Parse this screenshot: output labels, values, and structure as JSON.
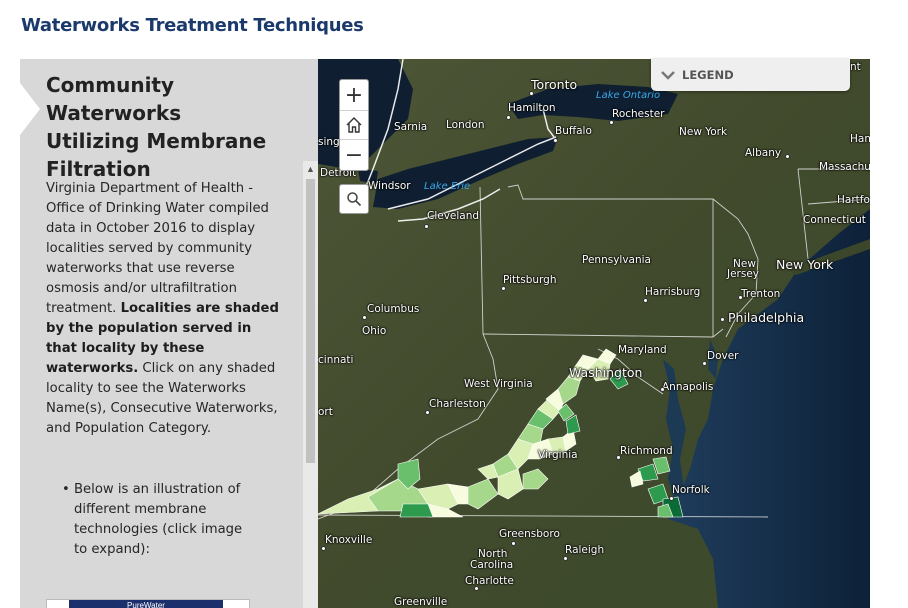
{
  "app": {
    "title": "Waterworks Treatment Techniques"
  },
  "panel": {
    "heading_line1": "Community Waterworks",
    "heading_line2": "Utilizing Membrane",
    "heading_line3": "Filtration",
    "body_intro": "Virginia Department of Health - Office of Drinking Water compiled data in October 2016 to display localities served by community waterworks that use reverse osmosis and/or ultrafiltration treatment.",
    "body_bold": "Localities are shaded by the population served in that locality by these waterworks.",
    "body_tail": "Click on any shaded locality to see the Waterworks Name(s), Consecutive Waterworks, and Population Category.",
    "bullet": "Below is an illustration of different membrane technologies (click image to expand):",
    "thumbnail_text": "PureWater"
  },
  "legend": {
    "label": "LEGEND",
    "icon": "chevron-down-icon"
  },
  "controls": {
    "zoom_in": "+",
    "zoom_out": "−",
    "home_icon": "home-icon",
    "search_icon": "search-icon"
  },
  "map": {
    "water_labels": [
      "Lake Ontario",
      "Lake Erie"
    ],
    "place_labels": [
      "Toronto",
      "Hamilton",
      "Sarnia",
      "London",
      "Rochester",
      "Buffalo",
      "New York",
      "Albany",
      "Massachu",
      "Hartfor",
      "Connecticut",
      "Windsor",
      "Detroit",
      "sing",
      "Cleveland",
      "Pennsylvania",
      "Pittsburgh",
      "Harrisburg",
      "New",
      "Jersey",
      "New York",
      "Trenton",
      "Philadelphia",
      "Columbus",
      "Ohio",
      "Maryland",
      "Dover",
      "cinnati",
      "Washington",
      "West Virginia",
      "Annapolis",
      "Charleston",
      "ort",
      "Virginia",
      "Richmond",
      "Norfolk",
      "Knoxville",
      "Greensboro",
      "Raleigh",
      "North",
      "Carolina",
      "Charlotte",
      "Greenville",
      "Ham",
      "nt"
    ],
    "choropleth_colors": [
      "#f7fcde",
      "#d9efb3",
      "#a6d88b",
      "#6abf6d",
      "#2e9a4e",
      "#0a6b36"
    ],
    "colors": {
      "land": "#3f4a2f",
      "water": "#16304f",
      "lake": "#0f1f31",
      "accent": "#1b3a6b"
    }
  }
}
